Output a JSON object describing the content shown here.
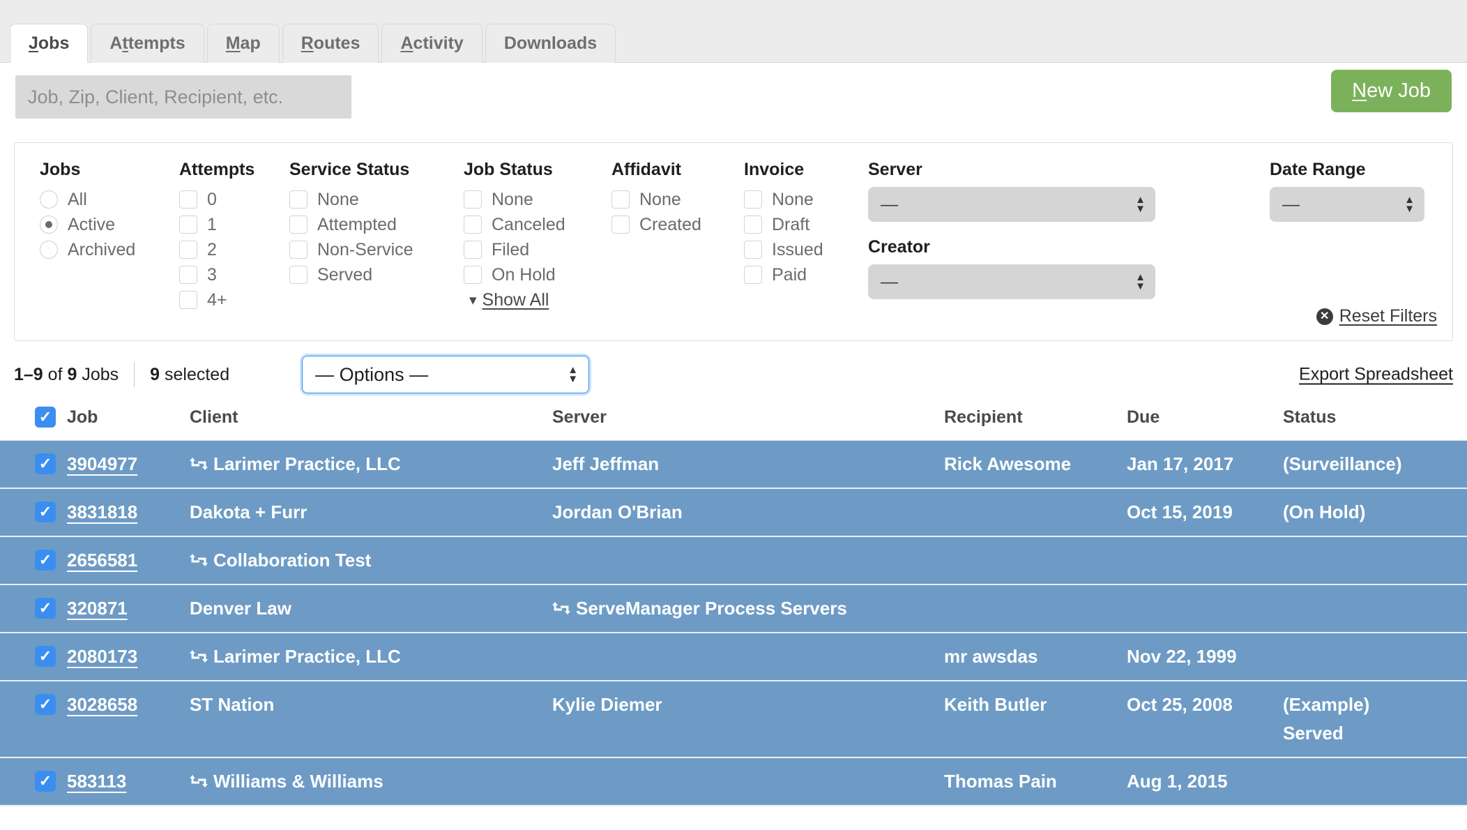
{
  "tabs": [
    {
      "label": "Jobs",
      "accel": "J",
      "active": true
    },
    {
      "label": "Attempts",
      "accel": "t",
      "active": false
    },
    {
      "label": "Map",
      "accel": "M",
      "active": false
    },
    {
      "label": "Routes",
      "accel": "R",
      "active": false
    },
    {
      "label": "Activity",
      "accel": "A",
      "active": false
    },
    {
      "label": "Downloads",
      "accel": "",
      "active": false
    }
  ],
  "search": {
    "placeholder": "Job, Zip, Client, Recipient, etc.",
    "value": ""
  },
  "new_job_button": {
    "label": "New Job",
    "accel": "N",
    "color": "#7cb15b"
  },
  "filters": {
    "jobs": {
      "title": "Jobs",
      "options": [
        "All",
        "Active",
        "Archived"
      ],
      "selected": "Active"
    },
    "attempts": {
      "title": "Attempts",
      "options": [
        "0",
        "1",
        "2",
        "3",
        "4+"
      ],
      "checked": []
    },
    "service_status": {
      "title": "Service Status",
      "options": [
        "None",
        "Attempted",
        "Non-Service",
        "Served"
      ],
      "checked": []
    },
    "job_status": {
      "title": "Job Status",
      "options": [
        "None",
        "Canceled",
        "Filed",
        "On Hold"
      ],
      "checked": [],
      "show_all_label": "Show All"
    },
    "affidavit": {
      "title": "Affidavit",
      "options": [
        "None",
        "Created"
      ],
      "checked": []
    },
    "invoice": {
      "title": "Invoice",
      "options": [
        "None",
        "Draft",
        "Issued",
        "Paid"
      ],
      "checked": []
    },
    "server": {
      "title": "Server",
      "value": "—"
    },
    "creator": {
      "title": "Creator",
      "value": "—"
    },
    "date_range": {
      "title": "Date Range",
      "value": "—"
    },
    "reset": {
      "label": "Reset Filters"
    }
  },
  "results": {
    "count_prefix": "1–9",
    "count_mid": " of ",
    "count_total": "9",
    "count_suffix": " Jobs",
    "selected_num": "9",
    "selected_label": " selected",
    "options_select": {
      "value": "— Options —",
      "focused": true
    },
    "export_label": "Export Spreadsheet"
  },
  "table": {
    "columns": [
      "Job",
      "Client",
      "Server",
      "Recipient",
      "Due",
      "Status"
    ],
    "header_checkbox_checked": true,
    "row_color": "#6e9bc5",
    "checkbox_color": "#3b8ef0",
    "rows": [
      {
        "checked": true,
        "job": "3904977",
        "client": "Larimer Practice, LLC",
        "client_icon": "exchange-icon",
        "server": "Jeff Jeffman",
        "server_icon": "",
        "recipient": "Rick Awesome",
        "due": "Jan 17, 2017",
        "status": "(Surveillance)",
        "status2": ""
      },
      {
        "checked": true,
        "job": "3831818",
        "client": "Dakota + Furr",
        "client_icon": "",
        "server": "Jordan O'Brian",
        "server_icon": "",
        "recipient": "",
        "due": "Oct 15, 2019",
        "status": "(On Hold)",
        "status2": ""
      },
      {
        "checked": true,
        "job": "2656581",
        "client": "Collaboration Test",
        "client_icon": "exchange-icon",
        "server": "",
        "server_icon": "",
        "recipient": "",
        "due": "",
        "status": "",
        "status2": ""
      },
      {
        "checked": true,
        "job": "320871",
        "client": "Denver Law",
        "client_icon": "",
        "server": "ServeManager Process Servers",
        "server_icon": "exchange-icon",
        "recipient": "",
        "due": "",
        "status": "",
        "status2": ""
      },
      {
        "checked": true,
        "job": "2080173",
        "client": "Larimer Practice, LLC",
        "client_icon": "exchange-icon",
        "server": "",
        "server_icon": "",
        "recipient": "mr awsdas",
        "due": "Nov 22, 1999",
        "status": "",
        "status2": ""
      },
      {
        "checked": true,
        "job": "3028658",
        "client": "ST Nation",
        "client_icon": "",
        "server": "Kylie Diemer",
        "server_icon": "",
        "recipient": "Keith Butler",
        "due": "Oct 25, 2008",
        "status": "(Example)",
        "status2": "Served"
      },
      {
        "checked": true,
        "job": "583113",
        "client": "Williams & Williams",
        "client_icon": "exchange-icon",
        "server": "",
        "server_icon": "",
        "recipient": "Thomas Pain",
        "due": "Aug 1, 2015",
        "status": "",
        "status2": ""
      }
    ]
  }
}
